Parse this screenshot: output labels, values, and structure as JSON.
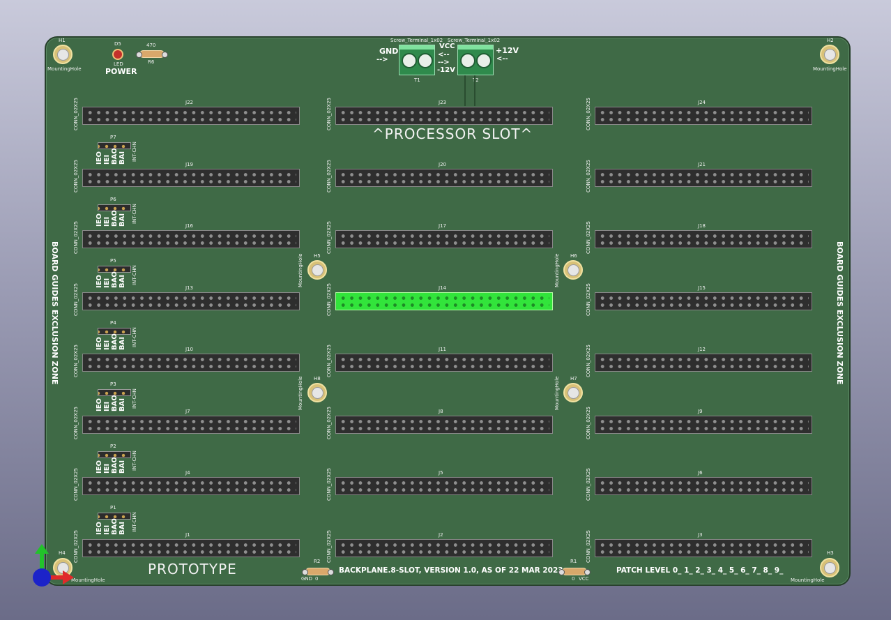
{
  "colors": {
    "board": "#3f6a46",
    "silkscreen": "#ffffff",
    "selected_connector": "#32e43b",
    "pad_gold": "#d8c178"
  },
  "mounting_holes": [
    {
      "ref": "H1",
      "value": "MountingHole"
    },
    {
      "ref": "H2",
      "value": "MountingHole"
    },
    {
      "ref": "H3",
      "value": "MountingHole"
    },
    {
      "ref": "H4",
      "value": "MountingHole"
    },
    {
      "ref": "H5",
      "value": "MountingHole"
    },
    {
      "ref": "H6",
      "value": "MountingHole"
    },
    {
      "ref": "H7",
      "value": "MountingHole"
    },
    {
      "ref": "H8",
      "value": "MountingHole"
    }
  ],
  "connector_value": "CONN_02X25",
  "connectors": {
    "row1": [
      "J22",
      "J23",
      "J24"
    ],
    "row2": [
      "J19",
      "J20",
      "J21"
    ],
    "row3": [
      "J16",
      "J17",
      "J18"
    ],
    "row4": [
      "J13",
      "J14",
      "J15"
    ],
    "row5": [
      "J10",
      "J11",
      "J12"
    ],
    "row6": [
      "J7",
      "J8",
      "J9"
    ],
    "row7": [
      "J4",
      "J5",
      "J6"
    ],
    "row8": [
      "J1",
      "J2",
      "J3"
    ]
  },
  "selected_connector": "J14",
  "jumpers": {
    "refs": [
      "P7",
      "P6",
      "P5",
      "P4",
      "P3",
      "P2",
      "P1"
    ],
    "value": "INT-CHN",
    "pin_labels": [
      "IEO",
      "IEI",
      "BAO",
      "BAI"
    ]
  },
  "power": {
    "led_ref": "D5",
    "led_value": "LED",
    "label": "POWER",
    "resistor_ref": "R6",
    "resistor_value": "470"
  },
  "terminals": {
    "t1": {
      "ref": "T1",
      "value": "Screw_Terminal_1x02"
    },
    "t2": {
      "ref": "T2",
      "value": "Screw_Terminal_1x02"
    },
    "gnd_label": "GND",
    "gnd_arrow": "-->",
    "vcc_label": "VCC",
    "vcc_arrow1": "<--",
    "m12_arrow": "-->",
    "m12_label": "-12V",
    "p12_label": "+12V",
    "p12_arrow": "<--"
  },
  "texts": {
    "processor_slot": "^PROCESSOR SLOT^",
    "exclusion_zone": "BOARD GUIDES EXCLUSION ZONE",
    "prototype": "PROTOTYPE",
    "version": "BACKPLANE.8-SLOT, VERSION 1.0, AS OF 22 MAR 2023",
    "patch_level": "PATCH LEVEL 0_ 1_ 2_ 3_ 4_ 5_ 6_ 7_ 8_ 9_"
  },
  "bottom_resistors": {
    "r2": {
      "ref": "R2",
      "left": "GND",
      "right": "0"
    },
    "r1": {
      "ref": "R1",
      "left": "0",
      "right": "VCC"
    }
  },
  "axes_icon": "3d-axes-icon"
}
